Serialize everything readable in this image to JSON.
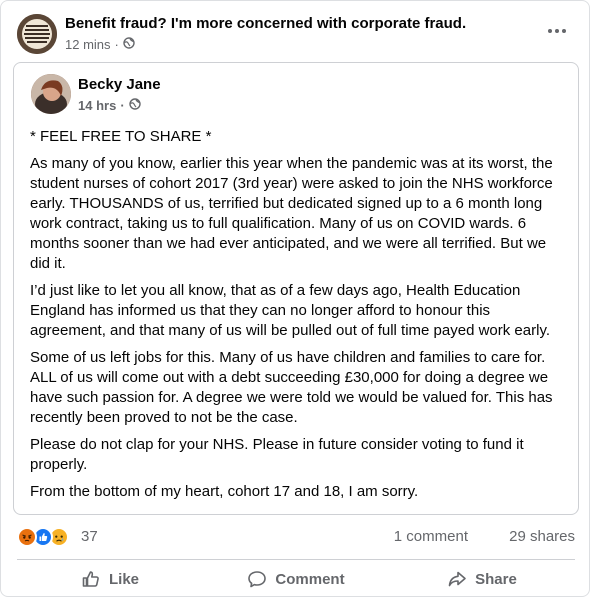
{
  "outer_post": {
    "title": "Benefit fraud? I'm more concerned with corporate fraud.",
    "time": "12 mins",
    "separator": "·",
    "privacy_icon": "globe-icon",
    "more_icon": "more-icon"
  },
  "shared_post": {
    "author": "Becky Jane",
    "time": "14 hrs",
    "separator": "·",
    "privacy_icon": "globe-icon",
    "paragraphs": [
      "* FEEL FREE TO SHARE *",
      "As many of you know, earlier this year when the pandemic was at its worst, the student nurses of cohort 2017 (3rd year) were asked to join the NHS workforce early. THOUSANDS of us, terrified but dedicated signed up to a 6 month long work contract, taking us to full qualification. Many of us on COVID wards. 6 months sooner than we had ever anticipated, and we were all terrified. But we did it.",
      "I’d just like to let you all know, that as of a few days ago, Health Education England has informed us that they can no longer afford to honour this agreement, and that many of us will be pulled out of full time payed work early.",
      "Some of us left jobs for this. Many of us have children and families to care for. ALL of us will come out with a debt succeeding £30,000 for doing a degree we have such passion for. A degree we were told we would be valued for. This has recently been proved to not be the case.",
      "Please do not clap for your NHS. Please in future consider voting to fund it properly.",
      "From the bottom of my heart, cohort 17 and 18, I am sorry."
    ]
  },
  "engagement": {
    "reaction_icons": [
      "angry-icon",
      "like-icon",
      "sad-icon"
    ],
    "reaction_count": "37",
    "comments": "1 comment",
    "shares": "29 shares"
  },
  "actions": {
    "like": "Like",
    "comment": "Comment",
    "share": "Share"
  },
  "colors": {
    "text": "#050505",
    "secondary": "#65676b",
    "border": "#ced0d4",
    "like_blue": "#1877f2",
    "angry": "#e9710f",
    "sad": "#f7b125"
  }
}
